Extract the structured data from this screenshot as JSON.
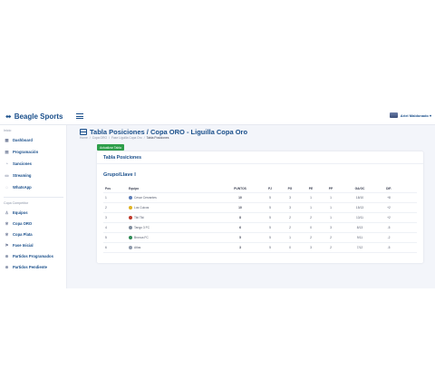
{
  "brand": {
    "name": "Beagle Sports"
  },
  "user": {
    "name": "Ariel Maldonado ▾"
  },
  "sidebar": {
    "section_main": "Inicio",
    "section_competition": "Copa Competitor",
    "main_items": [
      {
        "label": "Dashboard",
        "icon": "grid-icon"
      },
      {
        "label": "Programación",
        "icon": "calendar-icon"
      },
      {
        "label": "Sanciones",
        "icon": "warning-icon"
      },
      {
        "label": "Streaming",
        "icon": "video-icon"
      },
      {
        "label": "WhatsApp",
        "icon": "whatsapp-icon"
      }
    ],
    "competition_items": [
      {
        "label": "Equipos",
        "icon": "users-icon"
      },
      {
        "label": "Copa ORO",
        "icon": "trophy-icon"
      },
      {
        "label": "Copa Plata",
        "icon": "trophy-icon"
      },
      {
        "label": "Fase Inicial",
        "icon": "flag-icon"
      },
      {
        "label": "Partidos Programados",
        "icon": "soccer-icon"
      },
      {
        "label": "Partidos Pendiente",
        "icon": "soccer-icon"
      }
    ]
  },
  "page": {
    "title": "Tabla Posiciones / Copa ORO - Liguilla Copa Oro",
    "breadcrumb": [
      "Home",
      "/",
      "Copa ORO",
      "/",
      "Fase Liguilla Copa Oro",
      "/"
    ],
    "breadcrumb_active": "Tabla Posiciones",
    "update_button": "Actualizar Tabla"
  },
  "card": {
    "title": "Tabla Posiciones",
    "group": "Grupo/Llave I"
  },
  "table": {
    "headers": {
      "pos": "Pos",
      "team": "Equipo",
      "pts": "PUNTOS",
      "pj": "PJ",
      "pg": "PG",
      "pe": "PE",
      "pp": "PP",
      "gagc": "GA/GC",
      "dif": "DIF."
    },
    "rows": [
      {
        "pos": "1",
        "team": "Cesar Cervantes",
        "badge_color": "#5b7db8",
        "pts": "10",
        "pj": "5",
        "pg": "3",
        "pe": "1",
        "pp": "1",
        "gagc": "18/10",
        "dif": "+8"
      },
      {
        "pos": "2",
        "team": "Los Cuicos",
        "badge_color": "#e0b323",
        "pts": "10",
        "pj": "5",
        "pg": "3",
        "pe": "1",
        "pp": "1",
        "gagc": "15/13",
        "dif": "+2"
      },
      {
        "pos": "3",
        "team": "Tiki Tiki",
        "badge_color": "#c0392b",
        "pts": "8",
        "pj": "5",
        "pg": "2",
        "pe": "2",
        "pp": "1",
        "gagc": "13/11",
        "dif": "+2"
      },
      {
        "pos": "4",
        "team": "Tango 3 FC",
        "badge_color": "#7f8c9d",
        "pts": "6",
        "pj": "5",
        "pg": "2",
        "pe": "0",
        "pp": "3",
        "gagc": "8/13",
        "dif": "-5"
      },
      {
        "pos": "5",
        "team": "Bronca FC",
        "badge_color": "#2e8b57",
        "pts": "5",
        "pj": "5",
        "pg": "1",
        "pe": "2",
        "pp": "2",
        "gagc": "9/11",
        "dif": "-2"
      },
      {
        "pos": "6",
        "team": "Atlas",
        "badge_color": "#8e99ab",
        "pts": "3",
        "pj": "5",
        "pg": "0",
        "pe": "3",
        "pp": "2",
        "gagc": "7/12",
        "dif": "-5"
      }
    ]
  },
  "colors": {
    "brand": "#1a4f8b",
    "success": "#2e9e4a",
    "background": "#f3f5fa"
  }
}
